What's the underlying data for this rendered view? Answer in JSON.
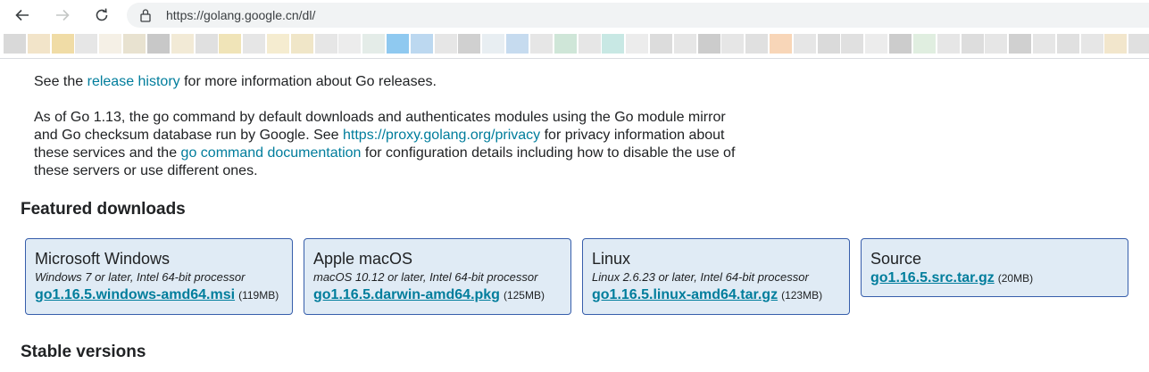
{
  "browser": {
    "back_icon": "arrow-left-icon",
    "forward_icon": "arrow-right-icon",
    "reload_icon": "reload-icon",
    "url": "https://golang.google.cn/dl/",
    "bookmark_colors": [
      "#d9d9d9",
      "#f2e4c9",
      "#f0dca6",
      "#e6e6e6",
      "#f5f0e6",
      "#e8e2d0",
      "#c8c8c8",
      "#f2ead6",
      "#e0e0e0",
      "#f0e4b8",
      "#e6e6e6",
      "#f5ecd0",
      "#f0e6c8",
      "#e6e6e6",
      "#ececec",
      "#e4ece8",
      "#8fc9f0",
      "#bcd8f0",
      "#e6e6e6",
      "#d0d0d0",
      "#e8eef2",
      "#c6dbef",
      "#e6e6e6",
      "#cfe6d8",
      "#e6e6e6",
      "#c8e8e4",
      "#ececec",
      "#dcdcdc",
      "#e6e6e6",
      "#cccccc",
      "#e6e6e6",
      "#e0e0e0",
      "#f8d6b8",
      "#e6e6e6",
      "#dadada",
      "#e0e0e0",
      "#ececec",
      "#cccccc",
      "#e0eee0",
      "#e6e6e6",
      "#dddddd",
      "#e6e6e6",
      "#d0d0d0",
      "#e6e6e6",
      "#e0e0e0",
      "#e6e6e6",
      "#f2e6cc",
      "#e0e0e0"
    ]
  },
  "intro": {
    "p1_pre": "See the ",
    "p1_link": "release history",
    "p1_post": " for more information about Go releases.",
    "p2_line1": "As of Go 1.13, the go command by default downloads and authenticates modules using the Go module mirror",
    "p2_line2_pre": "and Go checksum database run by Google. See ",
    "p2_line2_link": "https://proxy.golang.org/privacy",
    "p2_line2_post": " for privacy information about",
    "p2_line3_pre": "these services and the ",
    "p2_line3_link": "go command documentation",
    "p2_line3_post": " for configuration details including how to disable the use of",
    "p2_line4": "these servers or use different ones."
  },
  "featured_heading": "Featured downloads",
  "downloads": [
    {
      "platform": "Microsoft Windows",
      "desc": "Windows 7 or later, Intel 64-bit processor",
      "file": "go1.16.5.windows-amd64.msi",
      "size": "(119MB)"
    },
    {
      "platform": "Apple macOS",
      "desc": "macOS 10.12 or later, Intel 64-bit processor",
      "file": "go1.16.5.darwin-amd64.pkg",
      "size": "(125MB)"
    },
    {
      "platform": "Linux",
      "desc": "Linux 2.6.23 or later, Intel 64-bit processor",
      "file": "go1.16.5.linux-amd64.tar.gz",
      "size": "(123MB)"
    },
    {
      "platform": "Source",
      "file": "go1.16.5.src.tar.gz",
      "size": "(20MB)"
    }
  ],
  "stable_heading": "Stable versions"
}
